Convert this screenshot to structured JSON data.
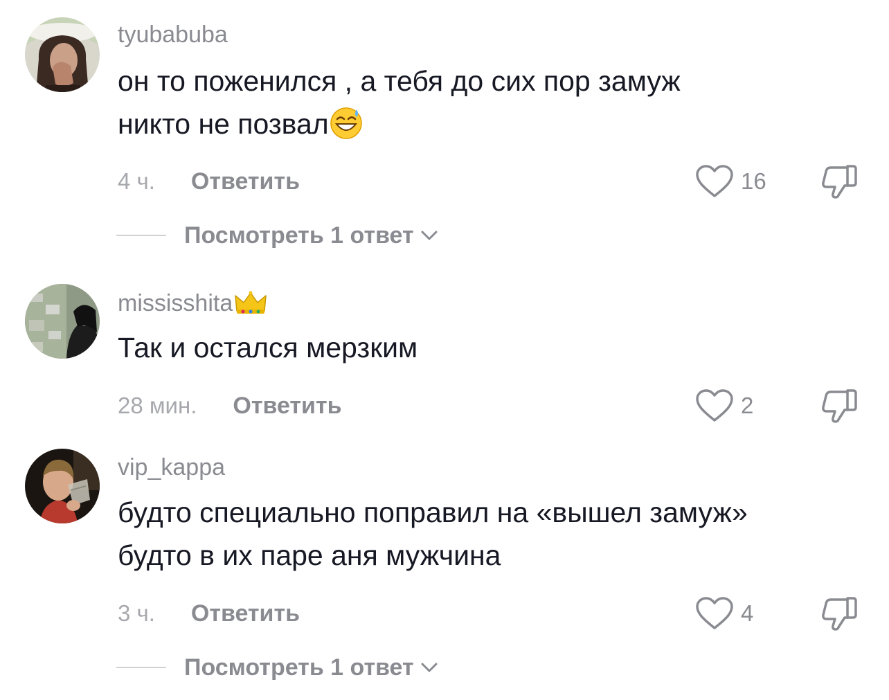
{
  "comments": [
    {
      "username": "tyubabuba",
      "text_line1": "он то поженился , а тебя до сих пор замуж",
      "text_line2": "никто не позвал",
      "emoji": "grinning-face-with-sweat",
      "time": "4 ч.",
      "reply_label": "Ответить",
      "likes": "16",
      "view_replies": "Посмотреть 1 ответ"
    },
    {
      "username": "mississhita",
      "badge": "crown",
      "text_line1": "Так и остался мерзким",
      "time": "28 мин.",
      "reply_label": "Ответить",
      "likes": "2"
    },
    {
      "username": "vip_kappa",
      "text_line1": "будто специально поправил на «вышел замуж»",
      "text_line2": "будто в их паре аня мужчина",
      "time": "3 ч.",
      "reply_label": "Ответить",
      "likes": "4",
      "view_replies": "Посмотреть 1 ответ"
    }
  ],
  "icons": {
    "like": "heart-outline-icon",
    "dislike": "thumbs-down-outline-icon",
    "expand": "chevron-down-icon"
  },
  "colors": {
    "primary_text": "#161823",
    "secondary_text": "#8a8b91",
    "muted_text": "#a7a8ad"
  }
}
